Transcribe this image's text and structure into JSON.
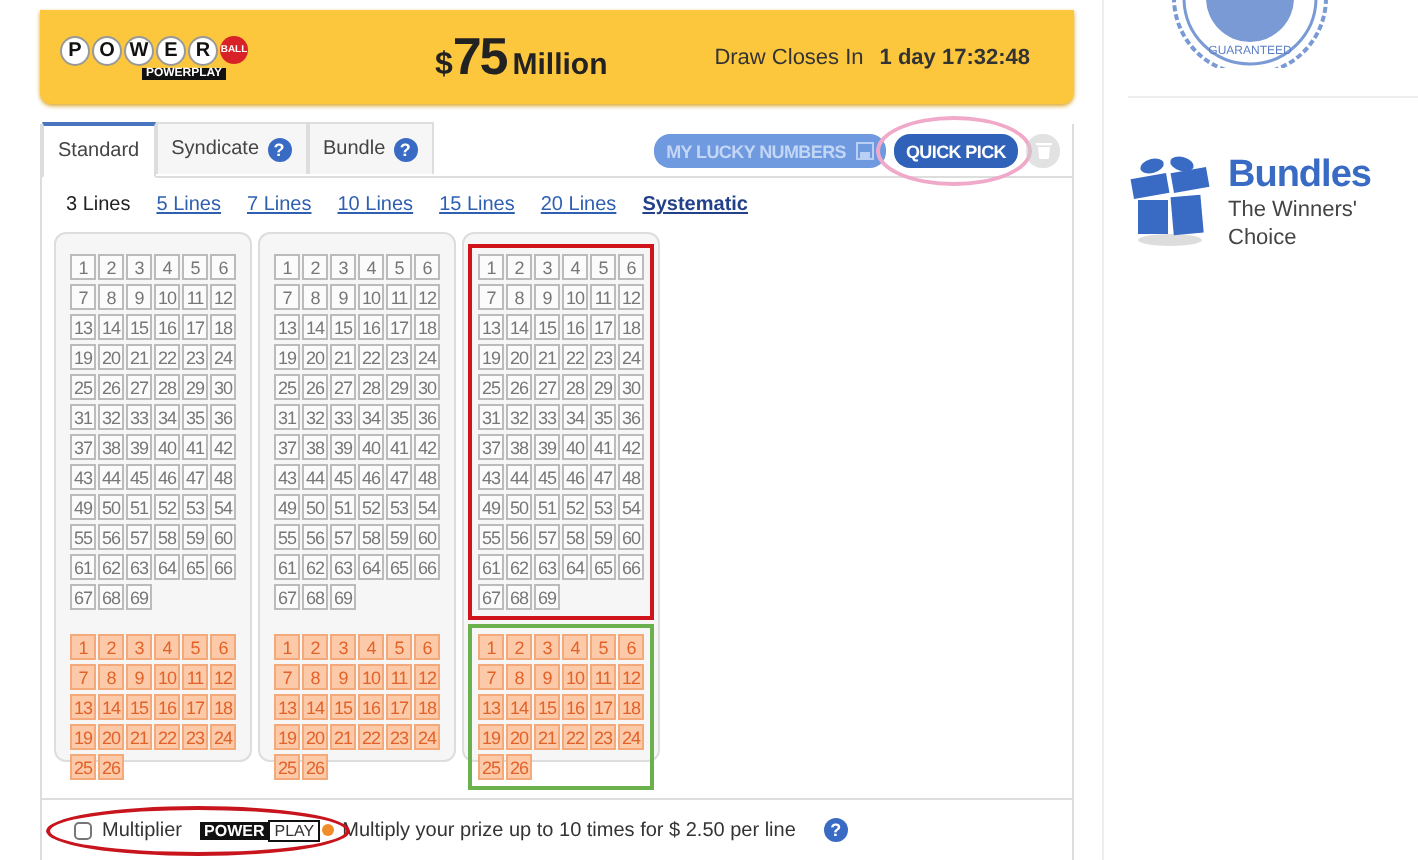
{
  "header": {
    "logo_letters": [
      "P",
      "O",
      "W",
      "E",
      "R"
    ],
    "logo_ball": "BALL",
    "logo_sub": "POWERPLAY",
    "jackpot": {
      "currency": "$",
      "amount": "75",
      "unit": "Million"
    },
    "draw_label": "Draw Closes In",
    "draw_time": "1 day 17:32:48"
  },
  "tabs": [
    {
      "label": "Standard",
      "selected": true,
      "help": false
    },
    {
      "label": "Syndicate",
      "selected": false,
      "help": true
    },
    {
      "label": "Bundle",
      "selected": false,
      "help": true
    }
  ],
  "help_mark": "?",
  "actions": [
    {
      "kind": "lucky",
      "label": "MY LUCKY NUMBERS",
      "circled": false,
      "disabled": false
    },
    {
      "kind": "quick",
      "label": "QUICK PICK",
      "circled": true,
      "disabled": false
    },
    {
      "kind": "trash",
      "circled": false,
      "disabled": true
    }
  ],
  "line_options": [
    {
      "label": "3 Lines",
      "selected": true,
      "bold": false
    },
    {
      "label": "5 Lines",
      "selected": false,
      "bold": false
    },
    {
      "label": "7 Lines",
      "selected": false,
      "bold": false
    },
    {
      "label": "10 Lines",
      "selected": false,
      "bold": false
    },
    {
      "label": "15 Lines",
      "selected": false,
      "bold": false
    },
    {
      "label": "20 Lines",
      "selected": false,
      "bold": false
    },
    {
      "label": "Systematic",
      "selected": false,
      "bold": true
    }
  ],
  "panels": [
    {
      "main_marked": false,
      "bonus_marked": false,
      "main": [
        "1",
        "2",
        "3",
        "4",
        "5",
        "6",
        "7",
        "8",
        "9",
        "10",
        "11",
        "12",
        "13",
        "14",
        "15",
        "16",
        "17",
        "18",
        "19",
        "20",
        "21",
        "22",
        "23",
        "24",
        "25",
        "26",
        "27",
        "28",
        "29",
        "30",
        "31",
        "32",
        "33",
        "34",
        "35",
        "36",
        "37",
        "38",
        "39",
        "40",
        "41",
        "42",
        "43",
        "44",
        "45",
        "46",
        "47",
        "48",
        "49",
        "50",
        "51",
        "52",
        "53",
        "54",
        "55",
        "56",
        "57",
        "58",
        "59",
        "60",
        "61",
        "62",
        "63",
        "64",
        "65",
        "66",
        "67",
        "68",
        "69"
      ],
      "bonus": [
        "1",
        "2",
        "3",
        "4",
        "5",
        "6",
        "7",
        "8",
        "9",
        "10",
        "11",
        "12",
        "13",
        "14",
        "15",
        "16",
        "17",
        "18",
        "19",
        "20",
        "21",
        "22",
        "23",
        "24",
        "25",
        "26"
      ]
    },
    {
      "main_marked": false,
      "bonus_marked": false,
      "main": [
        "1",
        "2",
        "3",
        "4",
        "5",
        "6",
        "7",
        "8",
        "9",
        "10",
        "11",
        "12",
        "13",
        "14",
        "15",
        "16",
        "17",
        "18",
        "19",
        "20",
        "21",
        "22",
        "23",
        "24",
        "25",
        "26",
        "27",
        "28",
        "29",
        "30",
        "31",
        "32",
        "33",
        "34",
        "35",
        "36",
        "37",
        "38",
        "39",
        "40",
        "41",
        "42",
        "43",
        "44",
        "45",
        "46",
        "47",
        "48",
        "49",
        "50",
        "51",
        "52",
        "53",
        "54",
        "55",
        "56",
        "57",
        "58",
        "59",
        "60",
        "61",
        "62",
        "63",
        "64",
        "65",
        "66",
        "67",
        "68",
        "69"
      ],
      "bonus": [
        "1",
        "2",
        "3",
        "4",
        "5",
        "6",
        "7",
        "8",
        "9",
        "10",
        "11",
        "12",
        "13",
        "14",
        "15",
        "16",
        "17",
        "18",
        "19",
        "20",
        "21",
        "22",
        "23",
        "24",
        "25",
        "26"
      ]
    },
    {
      "main_marked": true,
      "bonus_marked": true,
      "main": [
        "1",
        "2",
        "3",
        "4",
        "5",
        "6",
        "7",
        "8",
        "9",
        "10",
        "11",
        "12",
        "13",
        "14",
        "15",
        "16",
        "17",
        "18",
        "19",
        "20",
        "21",
        "22",
        "23",
        "24",
        "25",
        "26",
        "27",
        "28",
        "29",
        "30",
        "31",
        "32",
        "33",
        "34",
        "35",
        "36",
        "37",
        "38",
        "39",
        "40",
        "41",
        "42",
        "43",
        "44",
        "45",
        "46",
        "47",
        "48",
        "49",
        "50",
        "51",
        "52",
        "53",
        "54",
        "55",
        "56",
        "57",
        "58",
        "59",
        "60",
        "61",
        "62",
        "63",
        "64",
        "65",
        "66",
        "67",
        "68",
        "69"
      ],
      "bonus": [
        "1",
        "2",
        "3",
        "4",
        "5",
        "6",
        "7",
        "8",
        "9",
        "10",
        "11",
        "12",
        "13",
        "14",
        "15",
        "16",
        "17",
        "18",
        "19",
        "20",
        "21",
        "22",
        "23",
        "24",
        "25",
        "26"
      ]
    }
  ],
  "multiplier": {
    "checked": false,
    "circled": true,
    "label": "Multiplier",
    "logo_power": "POWER",
    "logo_play": "PLAY",
    "description": "Multiply your prize up to 10 times for $ 2.50 per line"
  },
  "sidebar": {
    "seal_text": "GUARANTEED",
    "promo_title": "Bundles",
    "promo_text": "The Winners' Choice"
  }
}
